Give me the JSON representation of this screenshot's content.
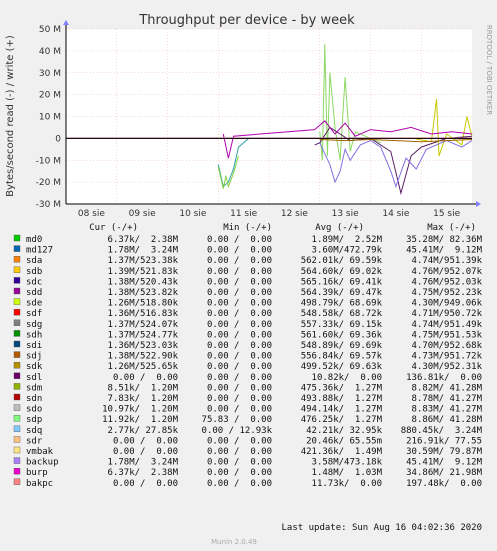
{
  "chart_data": {
    "type": "line",
    "title": "Throughput per device - by week",
    "ylabel": "Bytes/second read (-) / write (+)",
    "side_label": "RRDTOOL / TOBI OETIKER",
    "ylim": [
      -30000000,
      50000000
    ],
    "y_ticks": [
      {
        "value": 50000000,
        "label": "50 M"
      },
      {
        "value": 40000000,
        "label": "40 M"
      },
      {
        "value": 30000000,
        "label": "30 M"
      },
      {
        "value": 20000000,
        "label": "20 M"
      },
      {
        "value": 10000000,
        "label": "10 M"
      },
      {
        "value": 0,
        "label": "0"
      },
      {
        "value": -10000000,
        "label": "-10 M"
      },
      {
        "value": -20000000,
        "label": "-20 M"
      },
      {
        "value": -30000000,
        "label": "-30 M"
      }
    ],
    "x_range": [
      0,
      8
    ],
    "x_ticks": [
      "08 sie",
      "09 sie",
      "10 sie",
      "11 sie",
      "12 sie",
      "13 sie",
      "14 sie",
      "15 sie"
    ],
    "grid": true,
    "series": [
      {
        "name": "sdb",
        "color": "#c8c800",
        "values": [
          [
            6.9,
            -0.3
          ],
          [
            7.2,
            -1.5
          ],
          [
            7.3,
            18
          ],
          [
            7.35,
            -8
          ],
          [
            7.5,
            2
          ],
          [
            7.8,
            -3
          ],
          [
            7.9,
            10
          ],
          [
            8.0,
            1
          ]
        ]
      },
      {
        "name": "sdp",
        "color": "#8cd864",
        "values": [
          [
            5.0,
            3
          ],
          [
            5.05,
            -10
          ],
          [
            5.1,
            43
          ],
          [
            5.15,
            -8
          ],
          [
            5.2,
            30
          ],
          [
            5.3,
            5
          ],
          [
            5.4,
            -10
          ],
          [
            5.5,
            28
          ],
          [
            5.6,
            -6
          ],
          [
            5.7,
            3
          ],
          [
            6.0,
            0
          ],
          [
            6.2,
            -2
          ]
        ]
      },
      {
        "name": "sdo",
        "color": "#28a0a0",
        "values": [
          [
            3.0,
            -12
          ],
          [
            3.1,
            -22
          ],
          [
            3.2,
            -20
          ],
          [
            3.3,
            -14
          ],
          [
            3.4,
            -4
          ],
          [
            3.5,
            -2
          ],
          [
            3.6,
            0
          ]
        ]
      },
      {
        "name": "sdm",
        "color": "#88d040",
        "values": [
          [
            3.0,
            -13
          ],
          [
            3.1,
            -23
          ],
          [
            3.15,
            -17
          ],
          [
            3.2,
            -22
          ],
          [
            3.3,
            -16
          ],
          [
            3.4,
            -8
          ]
        ]
      },
      {
        "name": "sdl",
        "color": "#5a1e64",
        "values": [
          [
            4.9,
            -3
          ],
          [
            5.0,
            -2
          ],
          [
            5.2,
            5
          ],
          [
            5.4,
            2
          ],
          [
            5.6,
            -1
          ],
          [
            6.0,
            0
          ],
          [
            6.4,
            -6
          ],
          [
            6.6,
            -25
          ],
          [
            6.8,
            -8
          ],
          [
            7.0,
            -4
          ],
          [
            7.5,
            0
          ],
          [
            8.0,
            1
          ]
        ]
      },
      {
        "name": "sdi",
        "color": "#8070e0",
        "values": [
          [
            5.0,
            -2
          ],
          [
            5.1,
            -7
          ],
          [
            5.2,
            -12
          ],
          [
            5.3,
            -20
          ],
          [
            5.4,
            -15
          ],
          [
            5.5,
            -5
          ],
          [
            5.6,
            -10
          ],
          [
            5.8,
            -3
          ],
          [
            6.0,
            -1
          ],
          [
            6.2,
            -4
          ],
          [
            6.4,
            -15
          ],
          [
            6.5,
            -22
          ],
          [
            6.7,
            -9
          ],
          [
            6.9,
            -14
          ],
          [
            7.1,
            -5
          ],
          [
            7.5,
            -1
          ],
          [
            7.8,
            -4
          ],
          [
            8.0,
            -1
          ]
        ]
      },
      {
        "name": "sdd",
        "color": "#b000b0",
        "values": [
          [
            3.1,
            2
          ],
          [
            3.2,
            -9
          ],
          [
            3.3,
            1
          ],
          [
            4.9,
            4
          ],
          [
            5.1,
            8
          ],
          [
            5.3,
            2
          ],
          [
            5.5,
            7
          ],
          [
            5.7,
            1
          ],
          [
            6.0,
            4
          ],
          [
            6.4,
            3
          ],
          [
            6.8,
            5
          ],
          [
            7.2,
            2
          ],
          [
            7.6,
            3
          ],
          [
            8.0,
            2
          ]
        ]
      },
      {
        "name": "sdj",
        "color": "#a06400",
        "values": [
          [
            5.0,
            -0.5
          ],
          [
            5.5,
            -1
          ],
          [
            6.0,
            -0.5
          ],
          [
            6.5,
            -1
          ],
          [
            7.0,
            -1.5
          ],
          [
            7.5,
            -1
          ],
          [
            8.0,
            -0.5
          ]
        ]
      },
      {
        "name": "md0",
        "color": "#00cc00",
        "values": [
          [
            0,
            0
          ],
          [
            8.0,
            0
          ]
        ]
      },
      {
        "name": "md127",
        "color": "#0066b3",
        "values": [
          [
            0,
            0
          ],
          [
            8.0,
            0
          ]
        ]
      },
      {
        "name": "sda",
        "color": "#ff8000",
        "values": [
          [
            0,
            0
          ],
          [
            8.0,
            0
          ]
        ]
      },
      {
        "name": "sdc",
        "color": "#330099",
        "values": [
          [
            0,
            0
          ],
          [
            8.0,
            0
          ]
        ]
      },
      {
        "name": "sde",
        "color": "#ccff00",
        "values": [
          [
            0,
            0
          ],
          [
            8.0,
            0
          ]
        ]
      },
      {
        "name": "sdf",
        "color": "#ff0000",
        "values": [
          [
            0,
            0
          ],
          [
            8.0,
            0
          ]
        ]
      },
      {
        "name": "sdg",
        "color": "#808080",
        "values": [
          [
            0,
            0
          ],
          [
            8.0,
            0
          ]
        ]
      },
      {
        "name": "sdh",
        "color": "#008f00",
        "values": [
          [
            0,
            0
          ],
          [
            8.0,
            0
          ]
        ]
      },
      {
        "name": "sdk",
        "color": "#9a7a20",
        "values": [
          [
            0,
            0
          ],
          [
            8.0,
            0
          ]
        ]
      },
      {
        "name": "sdn",
        "color": "#a02020",
        "values": [
          [
            0,
            0
          ],
          [
            8.0,
            0
          ]
        ]
      },
      {
        "name": "sdq",
        "color": "#78b8f0",
        "values": [
          [
            0,
            0
          ],
          [
            8.0,
            0
          ]
        ]
      },
      {
        "name": "sdr",
        "color": "#f0b878",
        "values": [
          [
            0,
            0
          ],
          [
            8.0,
            0
          ]
        ]
      },
      {
        "name": "vmbak",
        "color": "#ffe070",
        "values": [
          [
            0,
            0
          ],
          [
            8.0,
            0
          ]
        ]
      },
      {
        "name": "backup",
        "color": "#a080d0",
        "values": [
          [
            0,
            0
          ],
          [
            8.0,
            0
          ]
        ]
      },
      {
        "name": "burp",
        "color": "#e040e0",
        "values": [
          [
            0,
            0
          ],
          [
            8.0,
            0
          ]
        ]
      },
      {
        "name": "bakpc",
        "color": "#f08080",
        "values": [
          [
            0,
            0
          ],
          [
            8.0,
            0
          ]
        ]
      }
    ]
  },
  "legend": {
    "headers": {
      "cur": "Cur (-/+)",
      "min": "Min (-/+)",
      "avg": "Avg (-/+)",
      "max": "Max (-/+)"
    },
    "rows": [
      {
        "name": "md0",
        "color": "#00cc00",
        "cur": "6.37k/  2.38M",
        "min": "0.00 /  0.00",
        "avg": "1.89M/  2.52M",
        "max": "35.28M/ 82.36M"
      },
      {
        "name": "md127",
        "color": "#0066b3",
        "cur": "1.78M/  3.24M",
        "min": "0.00 /  0.00",
        "avg": "3.60M/472.79k",
        "max": "45.41M/  9.12M"
      },
      {
        "name": "sda",
        "color": "#ff8000",
        "cur": "1.37M/523.38k",
        "min": "0.00 /  0.00",
        "avg": "562.01k/ 69.59k",
        "max": "4.74M/951.39k"
      },
      {
        "name": "sdb",
        "color": "#ffcc00",
        "cur": "1.39M/521.83k",
        "min": "0.00 /  0.00",
        "avg": "564.60k/ 69.02k",
        "max": "4.76M/952.07k"
      },
      {
        "name": "sdc",
        "color": "#330099",
        "cur": "1.38M/520.43k",
        "min": "0.00 /  0.00",
        "avg": "565.16k/ 69.41k",
        "max": "4.76M/952.03k"
      },
      {
        "name": "sdd",
        "color": "#990099",
        "cur": "1.38M/523.82k",
        "min": "0.00 /  0.00",
        "avg": "564.39k/ 69.47k",
        "max": "4.75M/952.23k"
      },
      {
        "name": "sde",
        "color": "#ccff00",
        "cur": "1.26M/518.80k",
        "min": "0.00 /  0.00",
        "avg": "498.79k/ 68.69k",
        "max": "4.30M/949.06k"
      },
      {
        "name": "sdf",
        "color": "#ff0000",
        "cur": "1.36M/516.83k",
        "min": "0.00 /  0.00",
        "avg": "548.58k/ 68.72k",
        "max": "4.71M/950.72k"
      },
      {
        "name": "sdg",
        "color": "#808080",
        "cur": "1.37M/524.07k",
        "min": "0.00 /  0.00",
        "avg": "557.33k/ 69.15k",
        "max": "4.74M/951.49k"
      },
      {
        "name": "sdh",
        "color": "#008f00",
        "cur": "1.37M/524.77k",
        "min": "0.00 /  0.00",
        "avg": "561.60k/ 69.36k",
        "max": "4.75M/951.53k"
      },
      {
        "name": "sdi",
        "color": "#00487d",
        "cur": "1.36M/523.03k",
        "min": "0.00 /  0.00",
        "avg": "548.89k/ 69.69k",
        "max": "4.70M/952.68k"
      },
      {
        "name": "sdj",
        "color": "#b35a00",
        "cur": "1.38M/522.90k",
        "min": "0.00 /  0.00",
        "avg": "556.84k/ 69.57k",
        "max": "4.73M/951.72k"
      },
      {
        "name": "sdk",
        "color": "#b38f00",
        "cur": "1.26M/525.65k",
        "min": "0.00 /  0.00",
        "avg": "499.52k/ 69.63k",
        "max": "4.30M/952.31k"
      },
      {
        "name": "sdl",
        "color": "#6b006b",
        "cur": "0.00 /  0.00",
        "min": "0.00 /  0.00",
        "avg": "10.82k/  0.00",
        "max": "136.81k/  0.00"
      },
      {
        "name": "sdm",
        "color": "#8fb300",
        "cur": "8.51k/  1.20M",
        "min": "0.00 /  0.00",
        "avg": "475.36k/  1.27M",
        "max": "8.82M/ 41.28M"
      },
      {
        "name": "sdn",
        "color": "#b30000",
        "cur": "7.83k/  1.20M",
        "min": "0.00 /  0.00",
        "avg": "493.88k/  1.27M",
        "max": "8.78M/ 41.27M"
      },
      {
        "name": "sdo",
        "color": "#bebebe",
        "cur": "10.97k/  1.20M",
        "min": "0.00 /  0.00",
        "avg": "494.14k/  1.27M",
        "max": "8.83M/ 41.27M"
      },
      {
        "name": "sdp",
        "color": "#80ff80",
        "cur": "11.92k/  1.20M",
        "min": "75.83 /  0.00",
        "avg": "476.25k/  1.27M",
        "max": "8.86M/ 41.28M"
      },
      {
        "name": "sdq",
        "color": "#80c9ff",
        "cur": "2.77k/ 27.85k",
        "min": "0.00 / 12.93k",
        "avg": "42.21k/ 32.95k",
        "max": "880.45k/  3.24M"
      },
      {
        "name": "sdr",
        "color": "#ffc080",
        "cur": "0.00 /  0.00",
        "min": "0.00 /  0.00",
        "avg": "20.46k/ 65.55m",
        "max": "216.91k/ 77.55"
      },
      {
        "name": "vmbak",
        "color": "#ffe680",
        "cur": "0.00 /  0.00",
        "min": "0.00 /  0.00",
        "avg": "421.36k/  1.49M",
        "max": "30.59M/ 79.87M"
      },
      {
        "name": "backup",
        "color": "#aa80ff",
        "cur": "1.78M/  3.24M",
        "min": "0.00 /  0.00",
        "avg": "3.58M/473.18k",
        "max": "45.41M/  9.12M"
      },
      {
        "name": "burp",
        "color": "#ee00cc",
        "cur": "6.37k/  2.38M",
        "min": "0.00 /  0.00",
        "avg": "1.48M/  1.03M",
        "max": "34.86M/ 21.98M"
      },
      {
        "name": "bakpc",
        "color": "#ff8080",
        "cur": "0.00 /  0.00",
        "min": "0.00 /  0.00",
        "avg": "11.73k/  0.00",
        "max": "197.48k/  0.00"
      }
    ]
  },
  "last_update": "Last update: Sun Aug 16 04:02:36 2020",
  "footer": "Munin 2.0.49"
}
